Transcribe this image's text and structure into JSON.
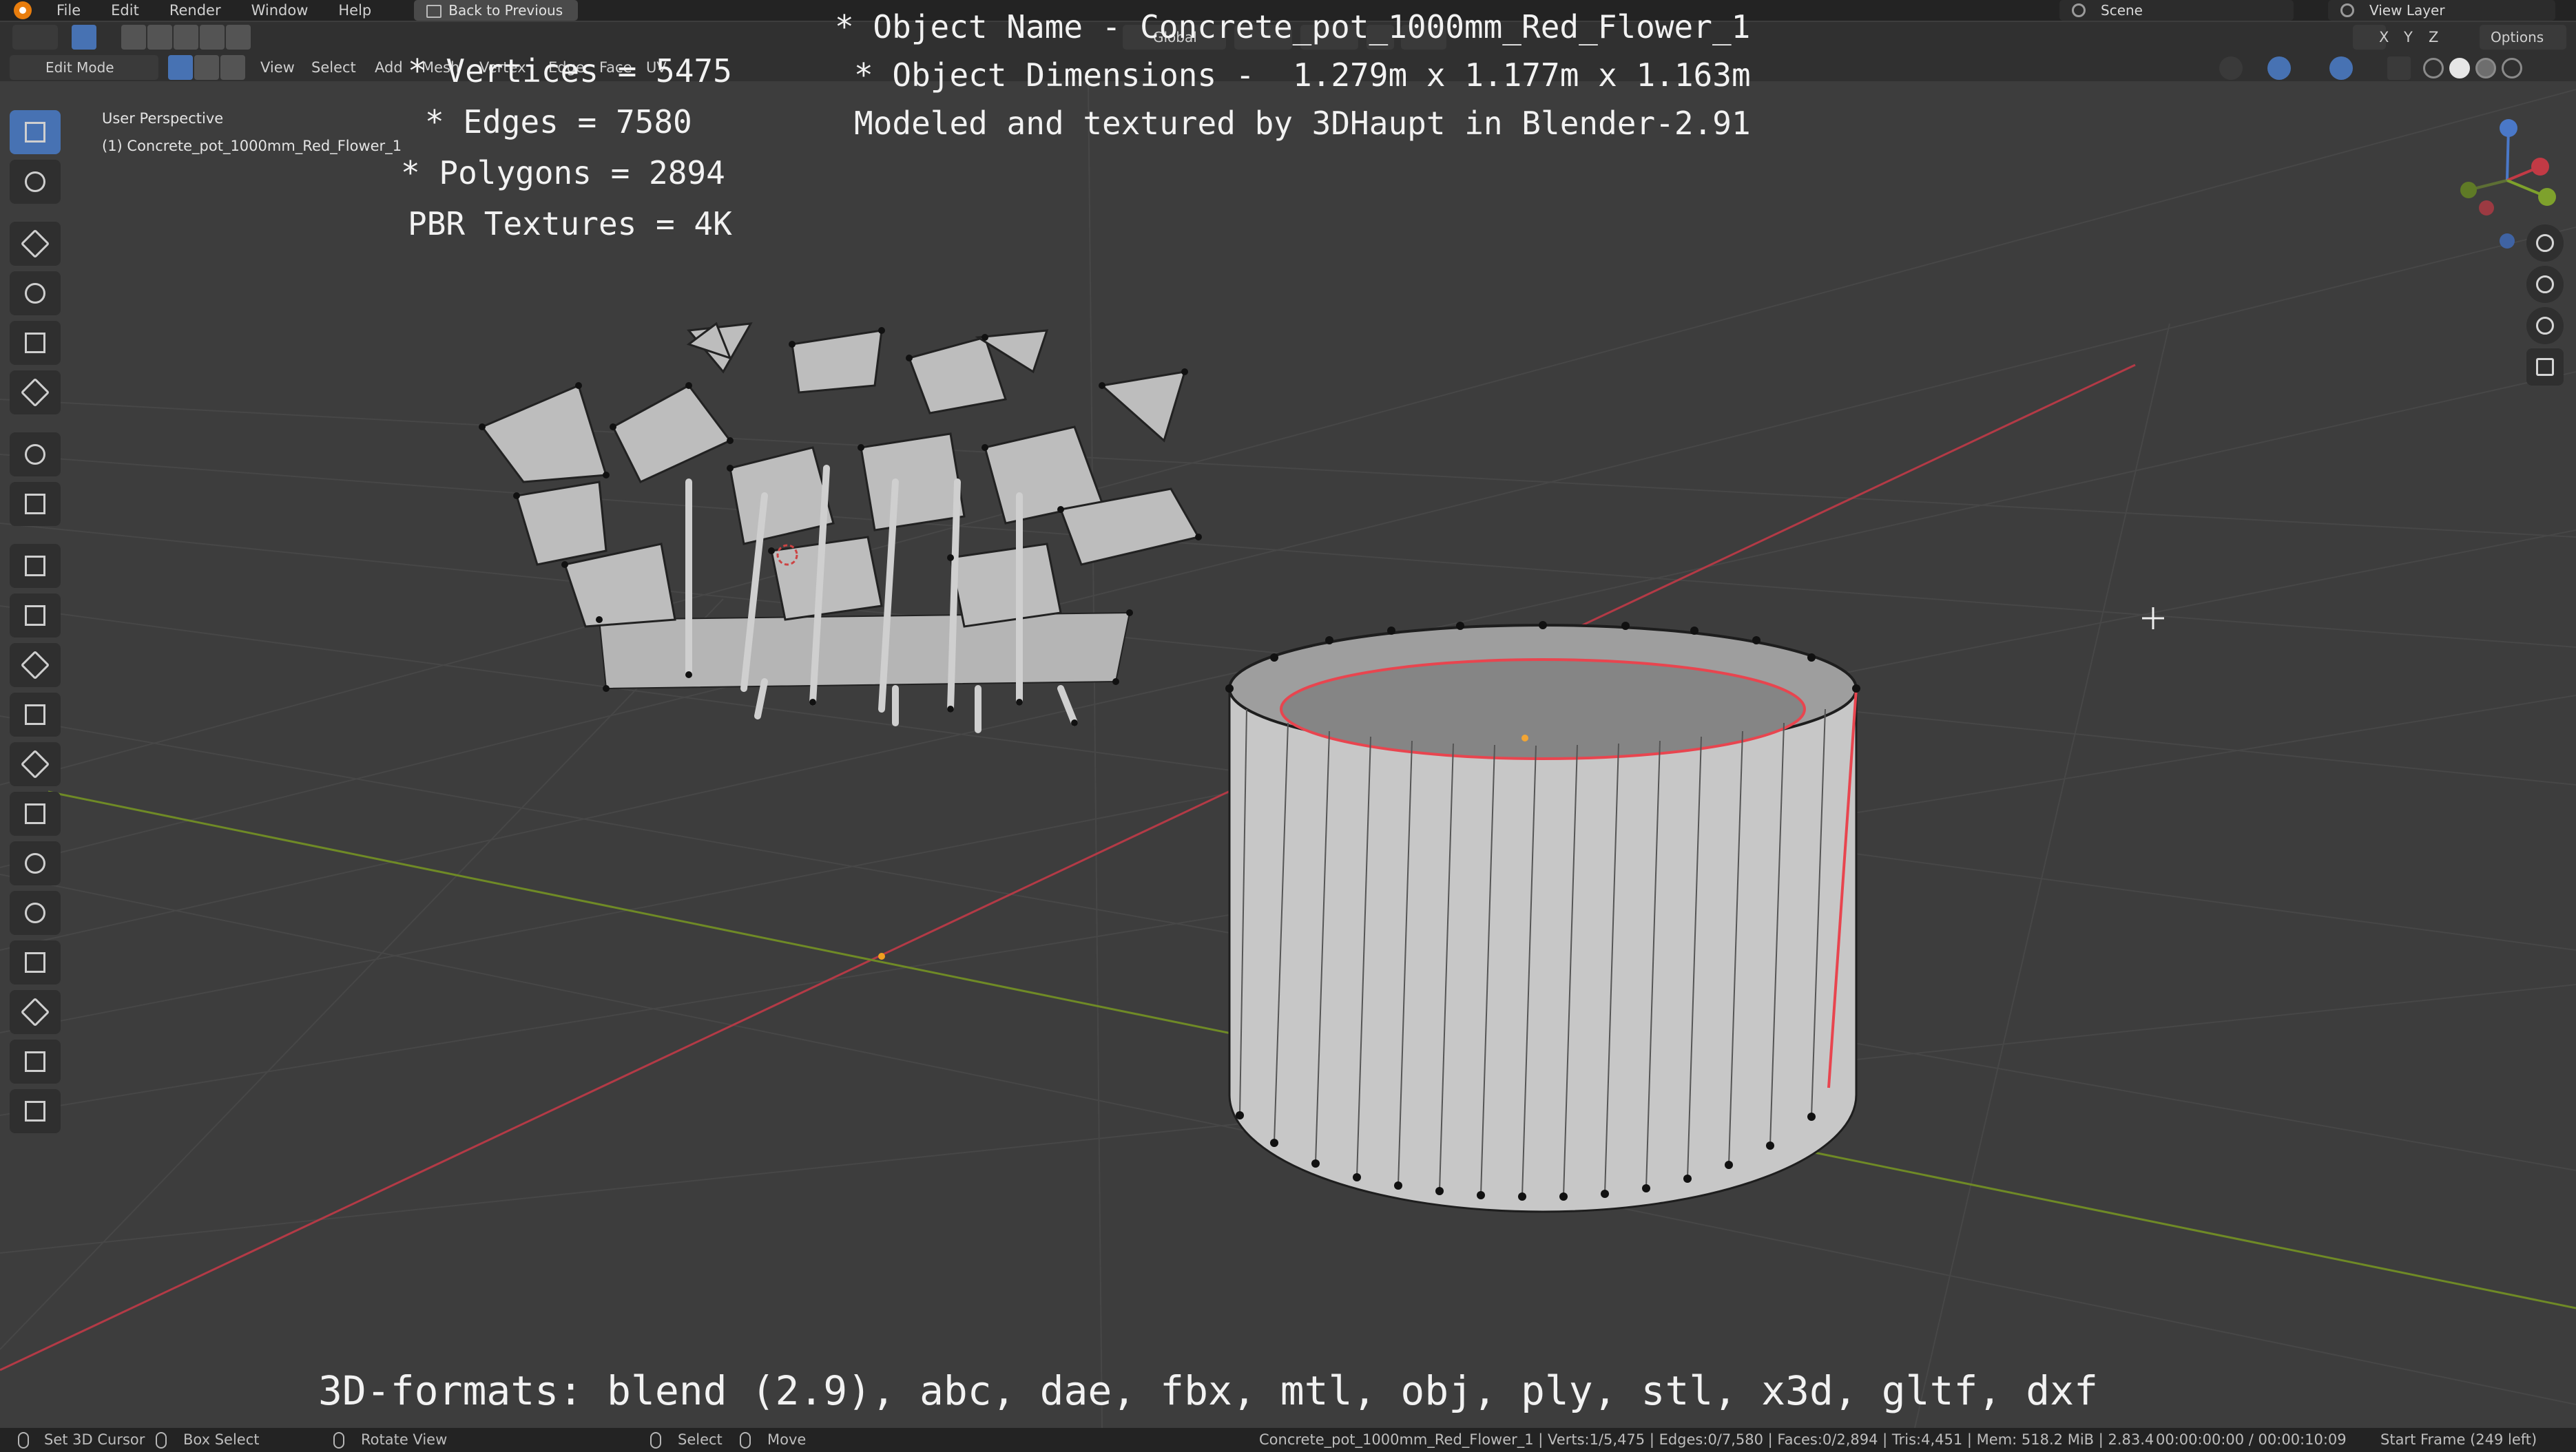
{
  "topbar": {
    "menus": [
      "File",
      "Edit",
      "Render",
      "Window",
      "Help"
    ],
    "back_button": "Back to Previous",
    "scene": "Scene",
    "view_layer": "View Layer"
  },
  "header": {
    "mode": "Edit Mode",
    "menus": [
      "View",
      "Select",
      "Add",
      "Mesh",
      "Vertex",
      "Edge",
      "Face",
      "UV"
    ],
    "orientation": "Global",
    "axes": [
      "X",
      "Y",
      "Z"
    ],
    "options": "Options"
  },
  "viewport": {
    "perspective_label": "User Perspective",
    "object_label": "(1) Concrete_pot_1000mm_Red_Flower_1"
  },
  "overlay": {
    "stats": [
      "* Vertices = 5475",
      "* Edges = 7580",
      "* Polygons = 2894",
      "PBR Textures = 4K"
    ],
    "info": [
      "* Object Name - Concrete_pot_1000mm_Red_Flower_1",
      "* Object Dimensions -  1.279m x 1.177m x 1.163m",
      "Modeled and textured by 3DHaupt in Blender-2.91"
    ],
    "formats": "3D-formats: blend (2.9), abc, dae, fbx, mtl, obj, ply, stl, x3d, gltf, dxf"
  },
  "statusbar": {
    "hints": [
      "Set 3D Cursor",
      "Box Select",
      "Rotate View",
      "Select",
      "Move"
    ],
    "stats": "Concrete_pot_1000mm_Red_Flower_1 | Verts:1/5,475 | Edges:0/7,580 | Faces:0/2,894 | Tris:4,451 | Mem: 518.2 MiB | 2.83.4",
    "time": "00:00:00:00 / 00:00:10:09",
    "frame": "Start Frame (249 left)"
  },
  "colors": {
    "accent": "#4772b3",
    "x_axis": "#c8404e",
    "y_axis": "#7e9d2a",
    "selected_edge": "#e8454f"
  },
  "icons": [
    "blender-logo-icon",
    "select-box-icon",
    "cursor-icon",
    "move-icon",
    "rotate-icon",
    "scale-icon",
    "transform-icon",
    "annotate-icon",
    "measure-icon",
    "extrude-icon",
    "inset-icon",
    "bevel-icon",
    "loop-cut-icon",
    "knife-icon",
    "poly-build-icon",
    "spin-icon",
    "smooth-icon",
    "edge-slide-icon",
    "shrink-fatten-icon",
    "shear-icon",
    "rip-icon",
    "zoom-icon",
    "pan-hand-icon",
    "camera-icon",
    "grid-icon"
  ]
}
